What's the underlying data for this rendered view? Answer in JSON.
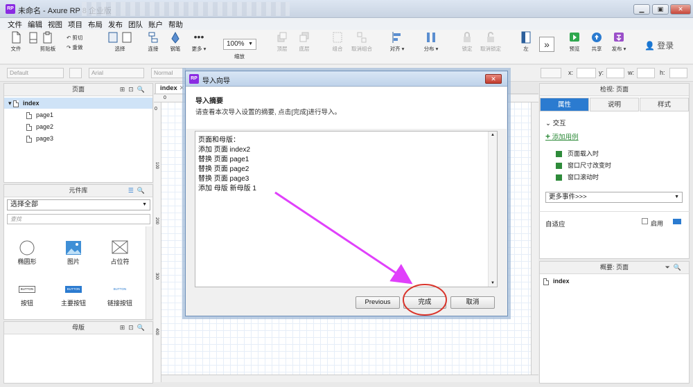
{
  "window": {
    "title": "未命名 - Axure RP 8 企业版",
    "app_badge": "RP",
    "controls": [
      "▁",
      "▣",
      "✕"
    ]
  },
  "menu": [
    "文件",
    "编辑",
    "视图",
    "项目",
    "布局",
    "发布",
    "团队",
    "账户",
    "帮助"
  ],
  "toolbar": {
    "file": "文件",
    "clipboard": "剪贴板",
    "cut": "剪切",
    "redo": "重做",
    "select": "选择",
    "connect": "连接",
    "pen": "钢笔",
    "more": "更多 ▾",
    "zoom_value": "100%",
    "zoom_label": "缩放",
    "top": "顶层",
    "bottom": "底层",
    "group": "组合",
    "ungroup": "取消组合",
    "align": "对齐 ▾",
    "distribute": "分布 ▾",
    "lock": "锁定",
    "unlock": "取消锁定",
    "left": "左",
    "preview": "预览",
    "share": "共享",
    "publish": "发布 ▾",
    "login": "登录"
  },
  "format": {
    "style": "Default",
    "font": "Arial",
    "weight": "Normal",
    "x_label": "x:",
    "y_label": "y:",
    "w_label": "w:",
    "h_label": "h:"
  },
  "pages_panel": {
    "title": "页面",
    "root": "index",
    "children": [
      "page1",
      "page2",
      "page3"
    ]
  },
  "library_panel": {
    "title": "元件库",
    "select": "选择全部",
    "search_placeholder": "查找",
    "items": [
      {
        "label": "椭圆形",
        "icon": "ellipse-icon"
      },
      {
        "label": "图片",
        "icon": "image-icon"
      },
      {
        "label": "占位符",
        "icon": "placeholder-icon"
      },
      {
        "label": "按钮",
        "icon": "button-icon",
        "preview": "BUTTON"
      },
      {
        "label": "主要按钮",
        "icon": "primary-button-icon",
        "preview": "BUTTON"
      },
      {
        "label": "链接按钮",
        "icon": "link-button-icon",
        "preview": "BUTTON"
      }
    ]
  },
  "masters_panel": {
    "title": "母版"
  },
  "canvas": {
    "tab": "index",
    "ruler_top": "0",
    "ruler_left": [
      "0",
      "100",
      "200",
      "300",
      "400"
    ]
  },
  "inspector": {
    "title": "检视: 页面",
    "tabs": [
      "属性",
      "说明",
      "样式"
    ],
    "section": "交互",
    "add_case": "添加用例",
    "events": [
      "页面载入时",
      "窗口尺寸改变时",
      "窗口滚动时"
    ],
    "more_events": "更多事件>>>",
    "adaptive": "自适应",
    "enable": "启用"
  },
  "outline": {
    "title": "概要: 页面",
    "root": "index"
  },
  "dialog": {
    "title": "导入向导",
    "heading": "导入摘要",
    "description": "请查看本次导入设置的摘要, 点击[完成]进行导入。",
    "summary": [
      "页面和母版：",
      "添加 页面 index2",
      "替换 页面 page1",
      "替换 页面 page2",
      "替换 页面 page3",
      "添加 母版 新母版 1"
    ],
    "buttons": {
      "previous": "Previous",
      "finish": "完成",
      "cancel": "取消"
    }
  },
  "colors": {
    "accent": "#2b7bd0",
    "annotation": "#e040fb",
    "highlight_circle": "#d9342b"
  }
}
